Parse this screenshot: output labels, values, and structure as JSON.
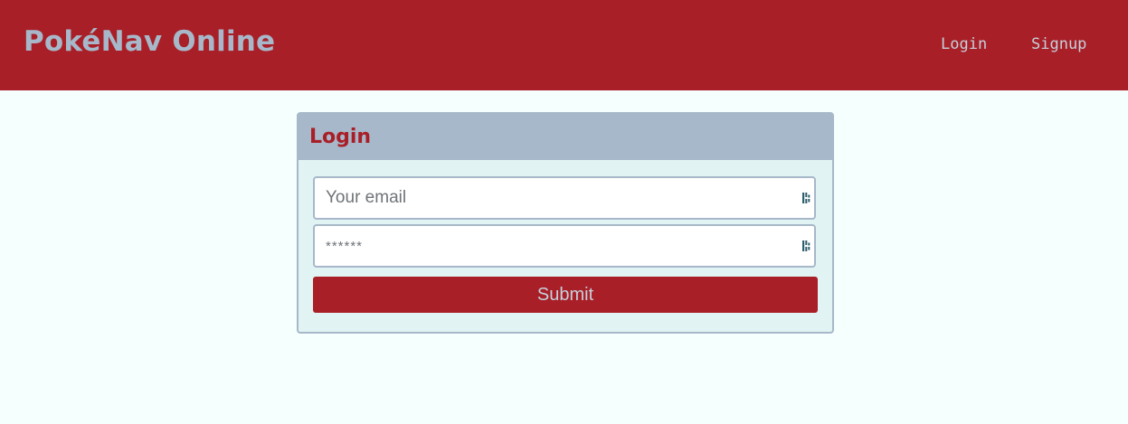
{
  "header": {
    "brand": "PokéNav Online",
    "nav": {
      "login": "Login",
      "signup": "Signup"
    }
  },
  "login_form": {
    "title": "Login",
    "email": {
      "placeholder": "Your email",
      "value": "",
      "icon": "password-manager-icon"
    },
    "password": {
      "placeholder": "******",
      "value": "",
      "icon": "password-manager-icon"
    },
    "submit_label": "Submit"
  },
  "colors": {
    "primary_red": "#a91f27",
    "slate": "#a6b8c9",
    "page_bg": "#f5fffd",
    "card_bg": "#e1f3f2"
  }
}
